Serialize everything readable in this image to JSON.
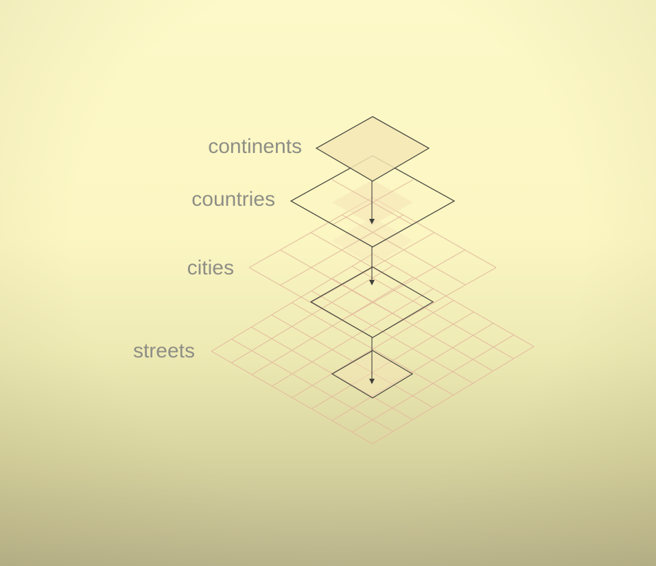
{
  "layers": [
    {
      "key": "continents",
      "label": "continents",
      "grid": 1,
      "highlighted": true
    },
    {
      "key": "countries",
      "label": "countries",
      "grid": 2,
      "highlighted": false
    },
    {
      "key": "cities",
      "label": "cities",
      "grid": 4,
      "highlighted": false
    },
    {
      "key": "streets",
      "label": "streets",
      "grid": 8,
      "highlighted": false
    }
  ],
  "colors": {
    "background_top": "#fdf9c8",
    "background_bottom": "#bcb68e",
    "label_text": "#8e8e86",
    "outline": "#4a4a42",
    "grid_line": "#e2b99c",
    "cell_fill": "#f6e4b8",
    "arrow": "#3f3f3a"
  }
}
